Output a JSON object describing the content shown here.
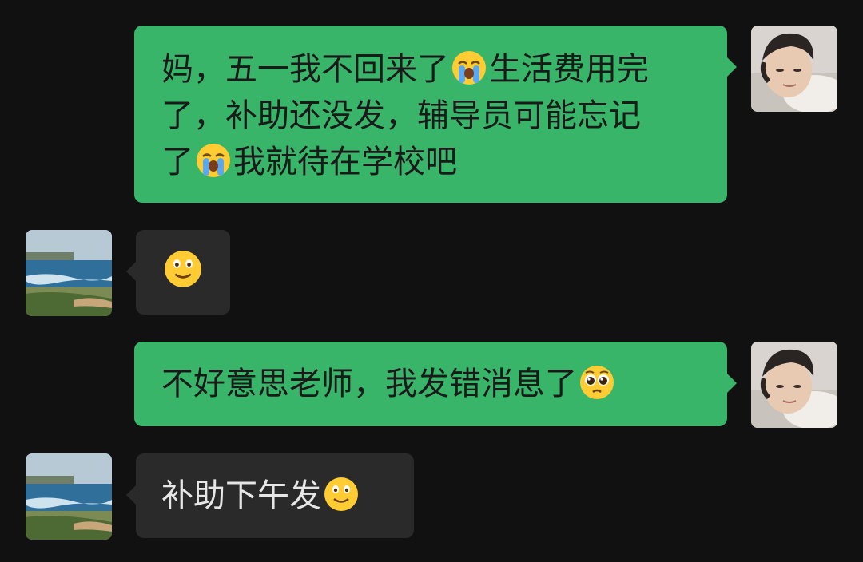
{
  "messages": [
    {
      "direction": "out",
      "lines": [
        {
          "a": "妈，五一我不回来了",
          "emoji": "loudly-crying-face",
          "b": "生活费用完"
        },
        {
          "a": "了，补助还没发，辅导员可能忘记",
          "emoji": "",
          "b": ""
        },
        {
          "a": "了",
          "emoji": "loudly-crying-face",
          "b": "我就待在学校吧"
        }
      ]
    },
    {
      "direction": "in",
      "lines": [
        {
          "a": "",
          "emoji": "slightly-smiling-face",
          "b": ""
        }
      ]
    },
    {
      "direction": "out",
      "lines": [
        {
          "a": "不好意思老师，我发错消息了",
          "emoji": "pleading-face",
          "b": ""
        }
      ]
    },
    {
      "direction": "in",
      "lines": [
        {
          "a": "补助下午发",
          "emoji": "slightly-smiling-face",
          "b": ""
        }
      ]
    }
  ],
  "colors": {
    "background": "#111111",
    "outgoing_bubble": "#39b56a",
    "incoming_bubble": "#2a2a2a"
  }
}
